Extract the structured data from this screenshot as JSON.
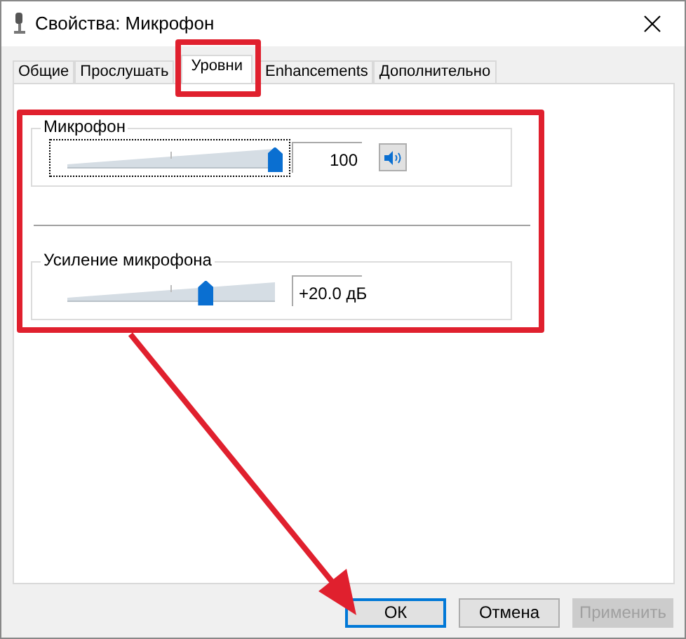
{
  "window": {
    "title": "Свойства: Микрофон"
  },
  "tabs": [
    {
      "label": "Общие",
      "selected": false
    },
    {
      "label": "Прослушать",
      "selected": false
    },
    {
      "label": "Уровни",
      "selected": true
    },
    {
      "label": "Enhancements",
      "selected": false
    },
    {
      "label": "Дополнительно",
      "selected": false
    }
  ],
  "groups": [
    {
      "title": "Микрофон",
      "level": 1.0,
      "reading": "100",
      "focused": true,
      "mute_button": true
    },
    {
      "title": "Усиление микрофона",
      "level": 0.667,
      "reading": "+20.0 дБ",
      "focused": false,
      "mute_button": false
    }
  ],
  "buttons": [
    {
      "label": "ОК",
      "default": true,
      "disabled": false
    },
    {
      "label": "Отмена",
      "default": false,
      "disabled": false
    },
    {
      "label": "Применить",
      "default": false,
      "disabled": true
    }
  ],
  "annotations": [
    {
      "kind": "frame",
      "color": "#e0202e"
    },
    {
      "kind": "frame",
      "color": "#e0202e"
    },
    {
      "kind": "arrow",
      "color": "#e0202e"
    }
  ]
}
